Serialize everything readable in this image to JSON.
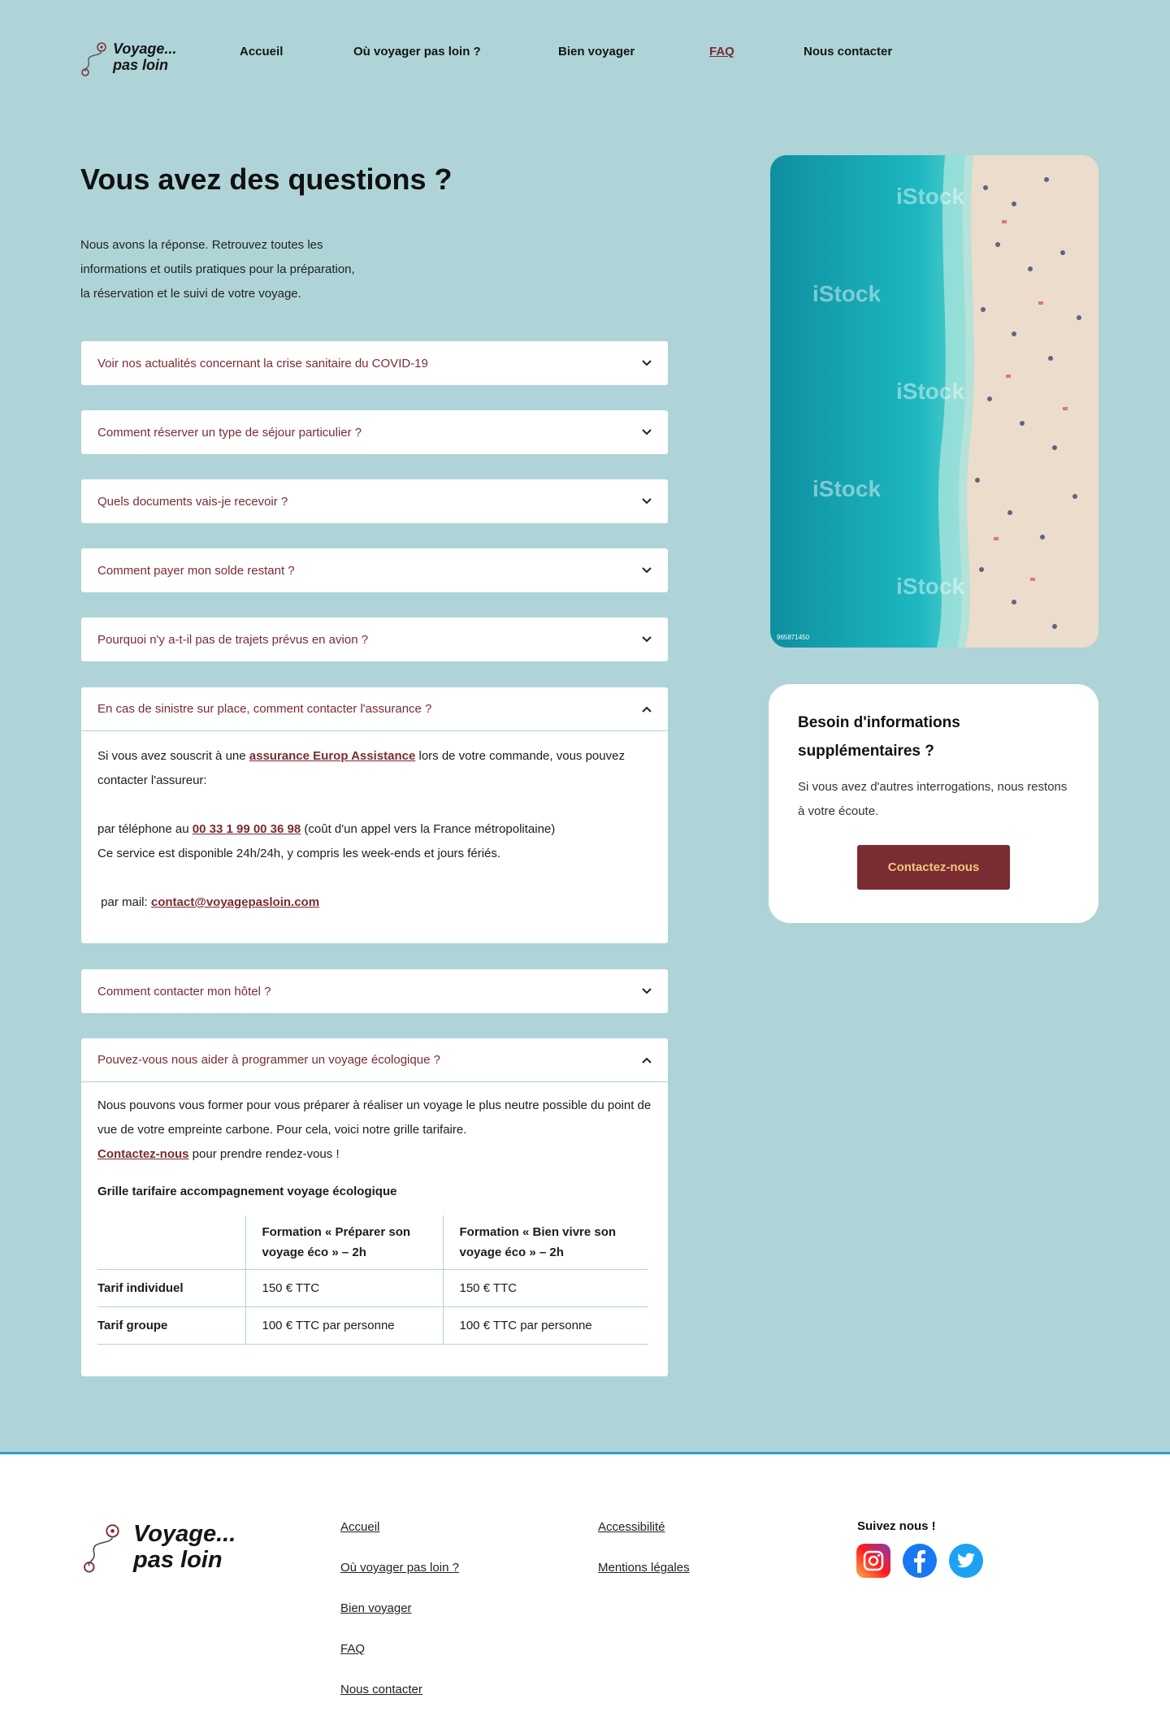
{
  "brand": {
    "logo_line1": "Voyage...",
    "logo_line2": "pas loin",
    "accent_color": "#7a2c32",
    "background_color": "#afd4d8"
  },
  "nav": {
    "items": [
      {
        "label": "Accueil"
      },
      {
        "label": "Où voyager pas loin ?"
      },
      {
        "label": "Bien voyager"
      },
      {
        "label": "FAQ",
        "active": true
      },
      {
        "label": "Nous contacter"
      }
    ]
  },
  "main": {
    "title": "Vous avez des questions ?",
    "intro_line1": "Nous avons la réponse. Retrouvez toutes les",
    "intro_line2": "informations et outils pratiques pour la préparation,",
    "intro_line3": "la réservation et le suivi de votre voyage."
  },
  "faq": [
    {
      "question": "Voir nos actualités concernant la crise sanitaire du COVID-19",
      "open": false
    },
    {
      "question": "Comment réserver un type de séjour particulier ?",
      "open": false
    },
    {
      "question": "Quels documents vais-je recevoir ?",
      "open": false
    },
    {
      "question": "Comment payer mon solde restant ?",
      "open": false
    },
    {
      "question": "Pourquoi n'y a-t-il pas de trajets prévus en avion ?",
      "open": false
    },
    {
      "question": "En cas de sinistre sur place, comment contacter l'assurance ?",
      "open": true,
      "answer": {
        "p1_before": "Si vous avez souscrit à une ",
        "p1_link": "assurance Europ Assistance",
        "p1_after": " lors de votre commande, vous pouvez contacter l'assureur:",
        "phone_before": "par téléphone au ",
        "phone_number": "00 33 1 99 00 36 98",
        "phone_after": " (coût d'un appel vers la France métropolitaine)",
        "availability": "Ce service est disponible 24h/24h, y compris les week-ends et jours fériés.",
        "mail_before": " par mail: ",
        "mail_link": "contact@voyagepasloin.com"
      }
    },
    {
      "question": "Comment contacter mon hôtel ?",
      "open": false
    },
    {
      "question": "Pouvez-vous nous aider à programmer un voyage écologique ?",
      "open": true,
      "answer": {
        "text": "Nous pouvons vous former pour vous préparer à réaliser un voyage le plus neutre possible du point de vue de votre empreinte carbone. Pour cela, voici notre grille tarifaire.",
        "link": "Contactez-nous",
        "after_link": " pour prendre rendez-vous !",
        "grid_title": "Grille tarifaire accompagnement voyage écologique",
        "table": {
          "headers": [
            "",
            "Formation « Préparer son voyage éco » – 2h",
            "Formation « Bien vivre son voyage éco » – 2h"
          ],
          "rows": [
            [
              "Tarif individuel",
              "150 € TTC",
              "150 € TTC"
            ],
            [
              "Tarif groupe",
              "100 € TTC par personne",
              "100 € TTC par personne"
            ]
          ]
        }
      }
    }
  ],
  "aside": {
    "image_caption": "iStock",
    "image_id": "965871450",
    "card_title_line1": "Besoin d'informations",
    "card_title_line2": "supplémentaires ?",
    "card_text": "Si vous avez d'autres interrogations, nous restons à votre écoute.",
    "card_button": "Contactez-nous"
  },
  "footer": {
    "col1": [
      "Accueil",
      "Où voyager pas loin ?",
      "Bien voyager",
      "FAQ",
      "Nous contacter"
    ],
    "col2": [
      "Accessibilité",
      "Mentions légales"
    ],
    "social_title": "Suivez nous !",
    "social": [
      "instagram-icon",
      "facebook-icon",
      "twitter-icon"
    ]
  }
}
